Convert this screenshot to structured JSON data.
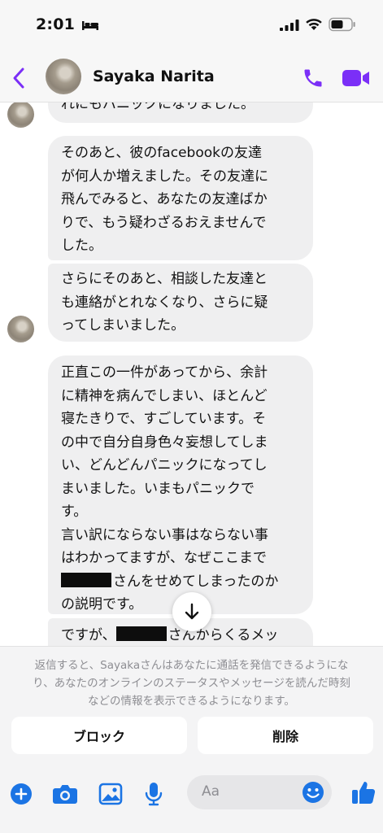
{
  "status_bar": {
    "time": "2:01"
  },
  "header": {
    "contact_name": "Sayaka Narita"
  },
  "messages": [
    {
      "text": "れにもパニックになりました。"
    },
    {
      "text": "そのあと、彼のfacebookの友達\nが何人か増えました。その友達に\n飛んでみると、あなたの友達ばか\nりで、もう疑わざるおえませんで\nした。"
    },
    {
      "text": "さらにそのあと、相談した友達と\nも連絡がとれなくなり、さらに疑\nってしまいました。"
    },
    {
      "text": "正直この一件があってから、余計\nに精神を病んでしまい、ほとんど\n寝たきりで、すごしています。そ\nの中で自分自身色々妄想してしま\nい、どんどんパニックになってし\nまいました。いまもパニックで\nす。\n言い訳にならない事はならない事\nはわかってますが、なぜここまで",
      "after_redaction": "さんをせめてしまったのか",
      "tail": "の説明です。"
    },
    {
      "after_redaction": "さんからくるメッ"
    }
  ],
  "request_panel": {
    "notice": "返信すると、Sayakaさんはあなたに通話を発信できるようにな\nり、あなたのオンラインのステータスやメッセージを読んだ時刻\nなどの情報を表示できるようになります。",
    "block_label": "ブロック",
    "delete_label": "削除"
  },
  "composer": {
    "placeholder": "Aa"
  },
  "colors": {
    "accent": "#7b2ff7",
    "like": "#1b74e4"
  },
  "icons": [
    "bed-icon",
    "signal-icon",
    "wifi-icon",
    "battery-icon",
    "back-icon",
    "phone-icon",
    "video-icon",
    "arrow-down-icon",
    "plus-icon",
    "camera-icon",
    "image-icon",
    "mic-icon",
    "emoji-icon",
    "thumbs-up-icon"
  ]
}
